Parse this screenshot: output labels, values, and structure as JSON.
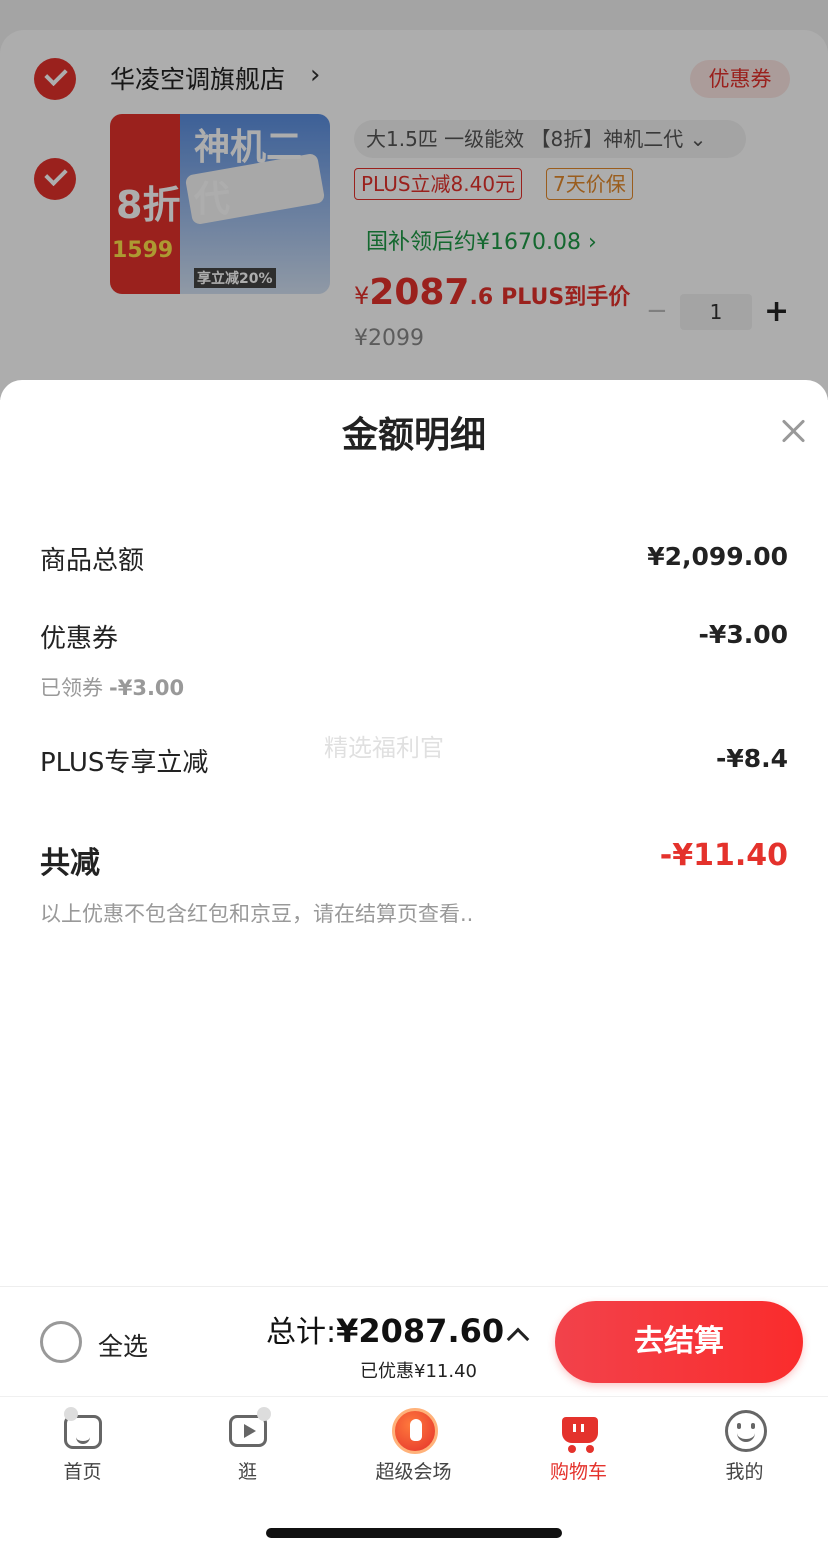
{
  "cart": {
    "shop_name": "华凌空调旗舰店",
    "shop_chevron": "›",
    "coupon_tag": "优惠券",
    "product": {
      "thumb_text_main": "神机二代",
      "thumb_text_discount": "8折",
      "thumb_text_price": "1599",
      "thumb_text_tag": "享立减20%",
      "variant": "大1.5匹 一级能效 【8折】神机二代 ⌄",
      "plus_chip": "PLUS立减8.40元",
      "guarantee_chip": "7天价保",
      "gov_subsidy": "国补领后约¥1670.08 ›",
      "price_symbol": "¥",
      "price_int": "2087",
      "price_dec": ".6",
      "price_tag": "PLUS到手价",
      "orig_price": "¥2099",
      "quantity": "1",
      "minus": "−",
      "plus": "+"
    }
  },
  "sheet": {
    "title": "金额明细",
    "watermark": "精选福利官",
    "rows": [
      {
        "label": "商品总额",
        "amount": "¥2,099.00"
      },
      {
        "label": "优惠券",
        "amount": "-¥3.00",
        "sub_label": "已领券",
        "sub_value": "-¥3.00"
      },
      {
        "label": "PLUS专享立减",
        "amount": "-¥8.4"
      }
    ],
    "total": {
      "label": "共减",
      "amount": "-¥11.40"
    },
    "note": "以上优惠不包含红包和京豆，请在结算页查看.."
  },
  "checkout": {
    "select_all": "全选",
    "sum_label": "总计:",
    "sum_value": "¥2087.60",
    "saved": "已优惠¥11.40",
    "button": "去结算"
  },
  "tabs": [
    {
      "label": "首页",
      "icon": "home-icon",
      "active": false
    },
    {
      "label": "逛",
      "icon": "video-icon",
      "active": false
    },
    {
      "label": "超级会场",
      "icon": "fire-icon",
      "active": false
    },
    {
      "label": "购物车",
      "icon": "cart-icon",
      "active": true
    },
    {
      "label": "我的",
      "icon": "smile-icon",
      "active": false
    }
  ],
  "colors": {
    "accent": "#e4322c",
    "green": "#1e9a46",
    "muted": "#999999"
  }
}
